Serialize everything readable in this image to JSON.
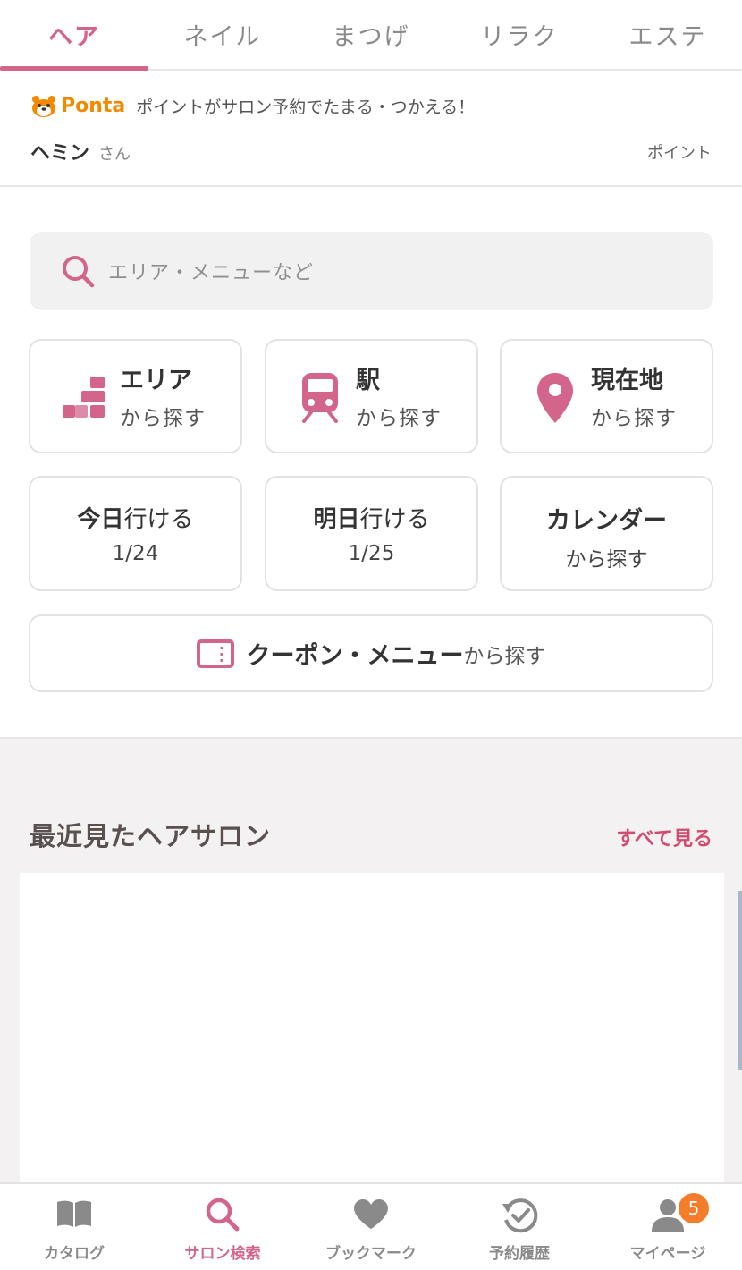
{
  "tabs": [
    {
      "label": "ヘア",
      "active": true
    },
    {
      "label": "ネイル",
      "active": false
    },
    {
      "label": "まつげ",
      "active": false
    },
    {
      "label": "リラク",
      "active": false
    },
    {
      "label": "エステ",
      "active": false
    }
  ],
  "ponta": {
    "logo_text": "Ponta",
    "message": "ポイントがサロン予約でたまる・つかえる！",
    "user_name": "ヘミン",
    "user_suffix": "さん",
    "points_label": "ポイント"
  },
  "search": {
    "placeholder": "エリア・メニューなど"
  },
  "quick_search": {
    "area": {
      "main": "エリア",
      "sub": "から探す",
      "icon": "area-icon"
    },
    "station": {
      "main": "駅",
      "sub": "から探す",
      "icon": "train-icon"
    },
    "location": {
      "main": "現在地",
      "sub": "から探す",
      "icon": "location-pin-icon"
    },
    "today": {
      "bold": "今日",
      "rest": "行ける",
      "date": "1/24"
    },
    "tomorrow": {
      "bold": "明日",
      "rest": "行ける",
      "date": "1/25"
    },
    "calendar": {
      "main": "カレンダー",
      "sub": "から探す"
    },
    "coupon": {
      "main": "クーポン・メニュー",
      "sub": "から探す",
      "icon": "coupon-icon"
    }
  },
  "recent": {
    "title": "最近見たヘアサロン",
    "see_all": "すべて見る"
  },
  "bottom_nav": [
    {
      "label": "カタログ",
      "icon": "book-icon",
      "active": false
    },
    {
      "label": "サロン検索",
      "icon": "search-icon",
      "active": true
    },
    {
      "label": "ブックマーク",
      "icon": "heart-icon",
      "active": false
    },
    {
      "label": "予約履歴",
      "icon": "history-icon",
      "active": false
    },
    {
      "label": "マイページ",
      "icon": "user-icon",
      "active": false,
      "badge": "5"
    }
  ],
  "colors": {
    "accent": "#d3648a",
    "link": "#d3496f",
    "badge": "#f57c2b",
    "ponta": "#f28a00"
  }
}
